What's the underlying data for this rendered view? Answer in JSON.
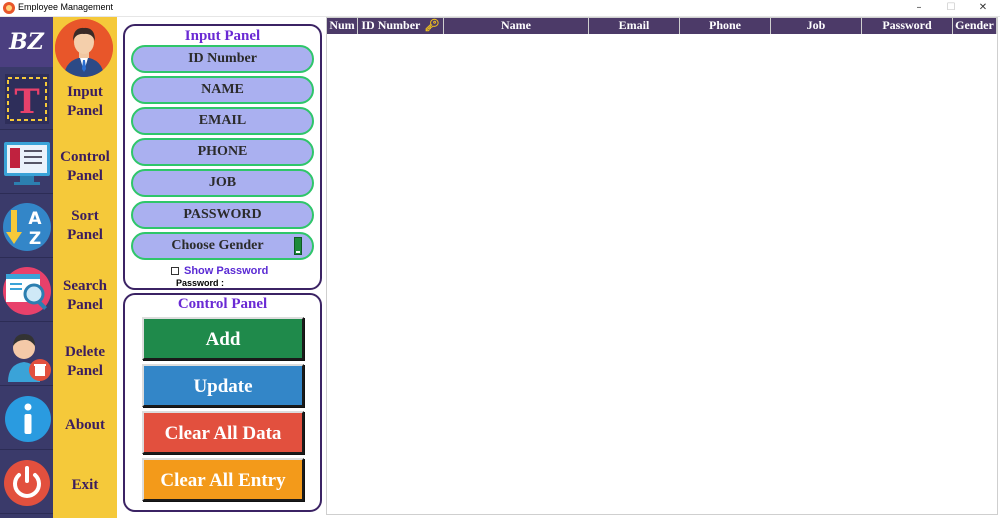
{
  "window": {
    "title": "Employee Management",
    "minimize": "–",
    "maximize": "☐",
    "close": "✕"
  },
  "logo": "BZ",
  "nav": [
    {
      "line1": "Input",
      "line2": "Panel"
    },
    {
      "line1": "Control",
      "line2": "Panel"
    },
    {
      "line1": "Sort",
      "line2": "Panel"
    },
    {
      "line1": "Search",
      "line2": "Panel"
    },
    {
      "line1": "Delete",
      "line2": "Panel"
    },
    {
      "line1": "About",
      "line2": ""
    },
    {
      "line1": "Exit",
      "line2": ""
    }
  ],
  "input_panel": {
    "title": "Input Panel",
    "fields": [
      "ID Number",
      "NAME",
      "EMAIL",
      "PHONE",
      "JOB",
      "PASSWORD",
      "Choose Gender"
    ],
    "show_password": "Show Password",
    "password_label": "Password :"
  },
  "control_panel": {
    "title": "Control Panel",
    "buttons": [
      "Add",
      "Update",
      "Clear All Data",
      "Clear All Entry"
    ]
  },
  "table": {
    "columns": [
      "Num",
      "ID Number",
      "Name",
      "Email",
      "Phone",
      "Job",
      "Password",
      "Gender"
    ]
  },
  "colors": {
    "nav_bg": "#f5c93a",
    "strip_bg": "#3a3a6a",
    "panel_border": "#3b2364",
    "field_bg": "#aab0f0",
    "field_border": "#2fc66a",
    "add": "#1f8a4b",
    "update": "#3386c8",
    "clear_data": "#e2503e",
    "clear_entry": "#f39a1a",
    "header_bg": "#4c3a68"
  }
}
